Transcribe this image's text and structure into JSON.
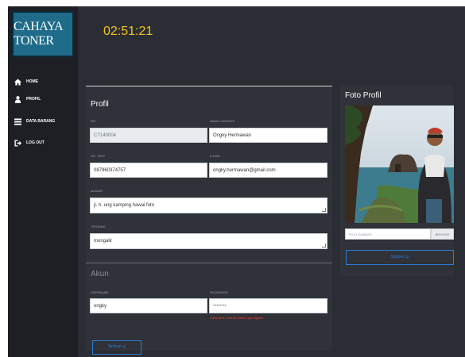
{
  "sidebar": {
    "logo_text": "CAHAYA TONER",
    "items": [
      {
        "label": "HOME",
        "icon": "home-icon"
      },
      {
        "label": "PROFIL",
        "icon": "user-icon"
      },
      {
        "label": "DATA BARANG",
        "icon": "list-icon"
      },
      {
        "label": "LOG OUT",
        "icon": "logout-icon"
      }
    ]
  },
  "header": {
    "clock": "02:51:21"
  },
  "profile": {
    "title": "Profil",
    "id_label": "NIK",
    "id_value": "CT140004",
    "name_label": "NAMA LENGKAP",
    "name_value": "Ongky Hermawan",
    "phone_label": "NO. TELP",
    "phone_value": "087960374757",
    "email_label": "E-MAIL",
    "email_value": "ongky.hermawan@gmail.com",
    "address_label": "ALAMAT",
    "address_value": "jl. h. ung kamping hawai foto",
    "about_label": "TENTANG",
    "about_value": "mongalir"
  },
  "account": {
    "title": "Akun",
    "username_label": "USERNAME",
    "username_value": "ongky",
    "password_label": "PASSWORD",
    "password_placeholder": "••••••••",
    "password_note": "Tidak perlu diisi jika tidak ingin diganti",
    "save_label": "Simpan 🖫"
  },
  "photo": {
    "title": "Foto Profil",
    "file_placeholder": "PILIH GAMBAR",
    "browse_label": "BROWSE",
    "save_label": "Simpan 🖫"
  },
  "colors": {
    "background": "#2a2d33",
    "sidebar": "#1d1f24",
    "clock": "#f5c518",
    "accent": "#2e7cd6",
    "warning": "#ff3b30"
  }
}
